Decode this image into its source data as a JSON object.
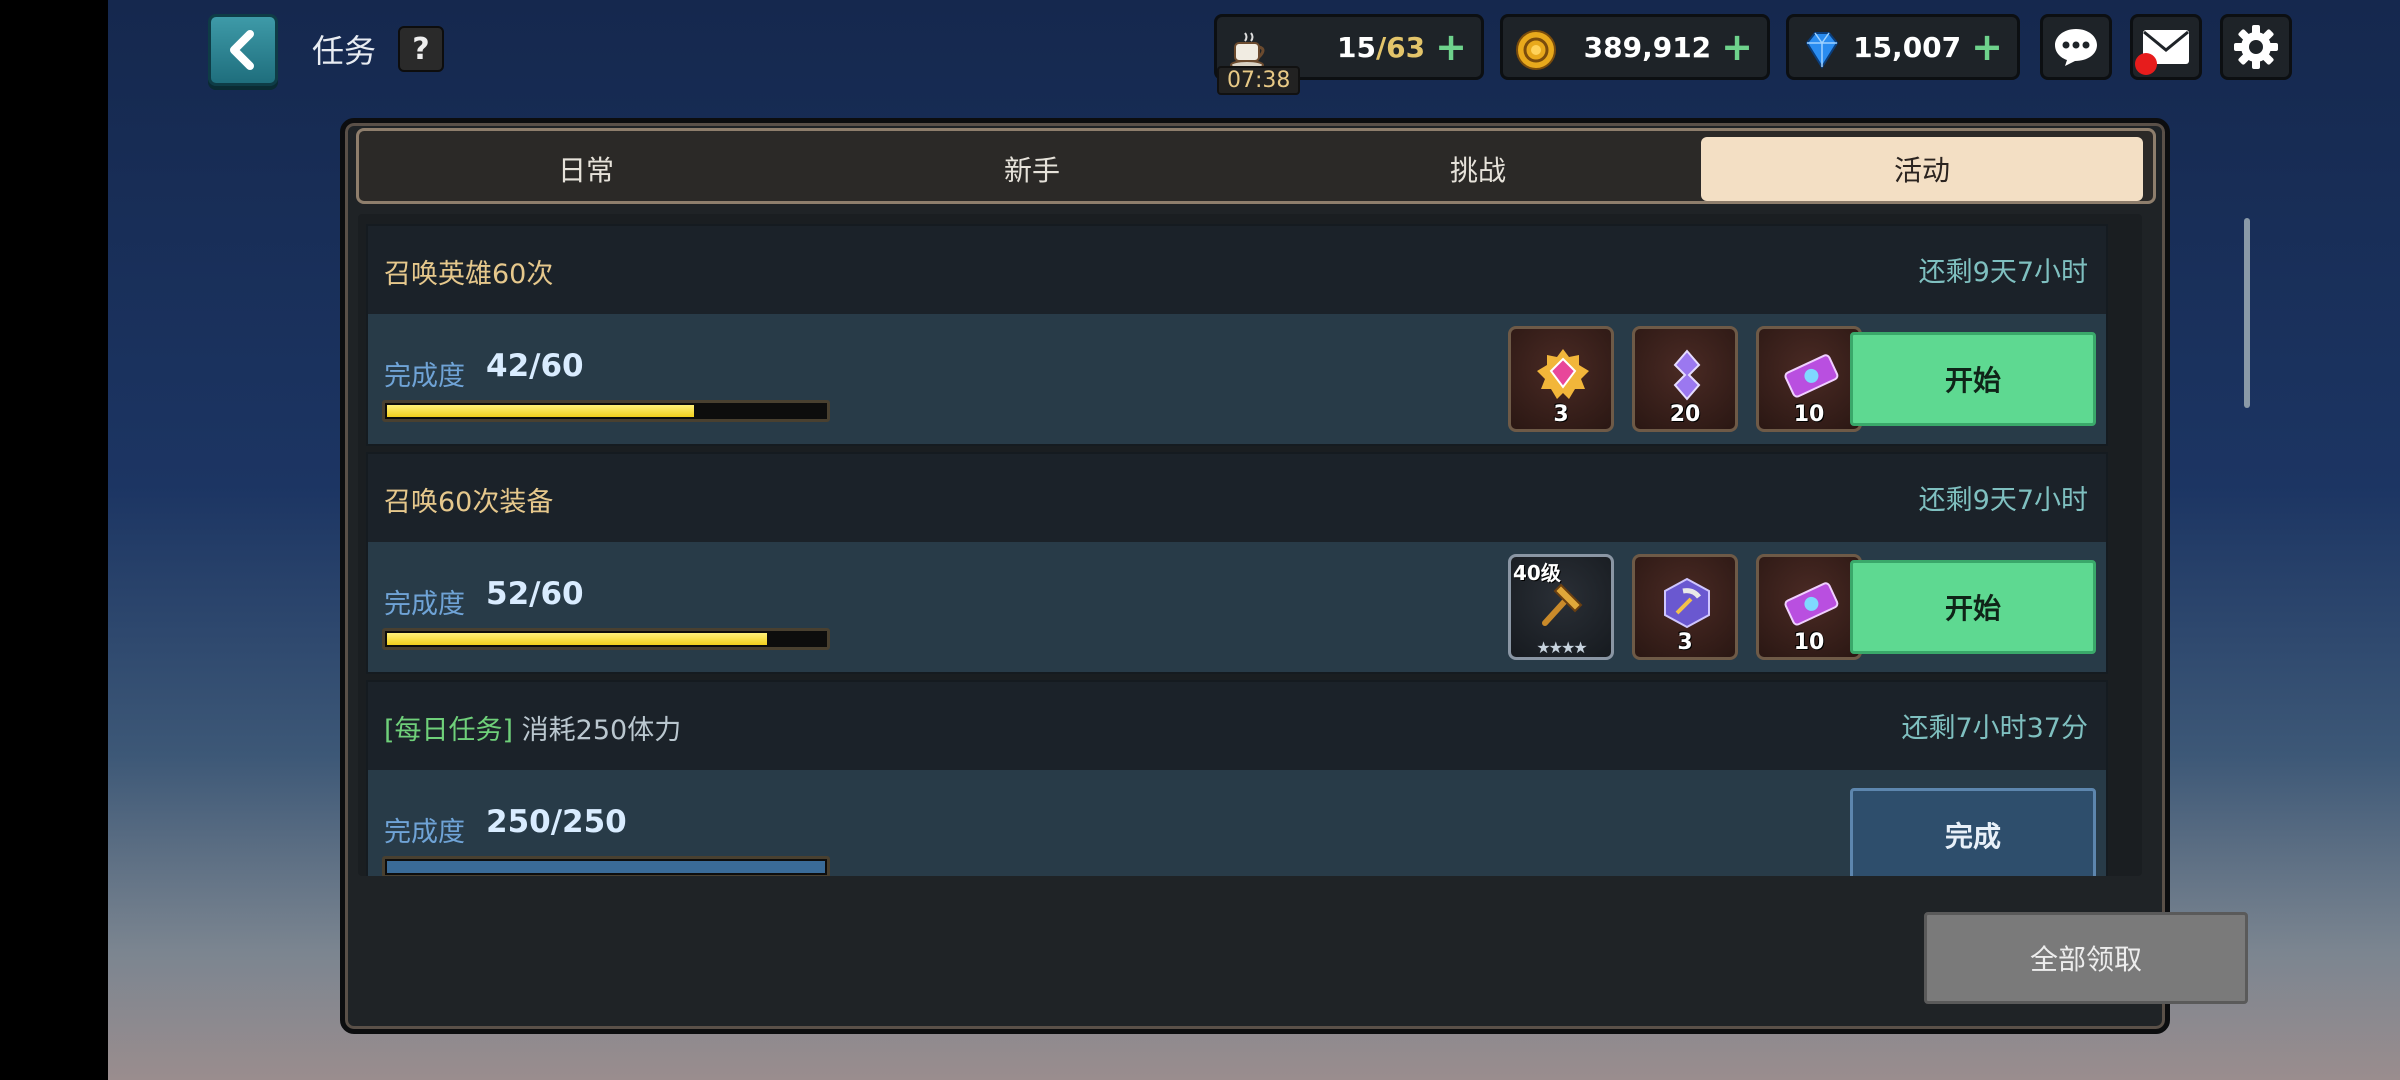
{
  "header": {
    "title": "任务",
    "help_label": "?"
  },
  "resources": {
    "stamina_current": "15",
    "stamina_max": "/63",
    "stamina_timer": "07:38",
    "gold": "389,912",
    "gems": "15,007",
    "plus": "+"
  },
  "tabs": [
    {
      "label": "日常",
      "active": false
    },
    {
      "label": "新手",
      "active": false
    },
    {
      "label": "挑战",
      "active": false
    },
    {
      "label": "活动",
      "active": true
    }
  ],
  "quests": [
    {
      "title": "召唤英雄60次",
      "time_left": "还剩9天7小时",
      "progress_label": "完成度",
      "progress_text": "42/60",
      "progress": 0.7,
      "rewards": [
        {
          "icon": "pink-gem-badge-icon",
          "count": "3"
        },
        {
          "icon": "purple-crystal-icon",
          "count": "20"
        },
        {
          "icon": "summon-ticket-icon",
          "count": "10"
        }
      ],
      "button": "开始"
    },
    {
      "title": "召唤60次装备",
      "time_left": "还剩9天7小时",
      "progress_label": "完成度",
      "progress_text": "52/60",
      "progress": 0.8667,
      "rewards": [
        {
          "icon": "hammer-weapon-icon",
          "level": "40级",
          "stars": "★★★★"
        },
        {
          "icon": "pickaxe-hexagon-icon",
          "count": "3"
        },
        {
          "icon": "summon-ticket-icon",
          "count": "10"
        }
      ],
      "button": "开始"
    },
    {
      "tag": "[每日任务]",
      "title": "消耗250体力",
      "time_left": "还剩7小时37分",
      "progress_label": "完成度",
      "progress_text": "250/250",
      "progress": 1.0,
      "button": "完成"
    }
  ],
  "claim_all": "全部领取",
  "colors": {
    "accent_green": "#5ed991",
    "progress_yellow": "#f2cf1c",
    "tab_active": "#f3dfc4"
  }
}
